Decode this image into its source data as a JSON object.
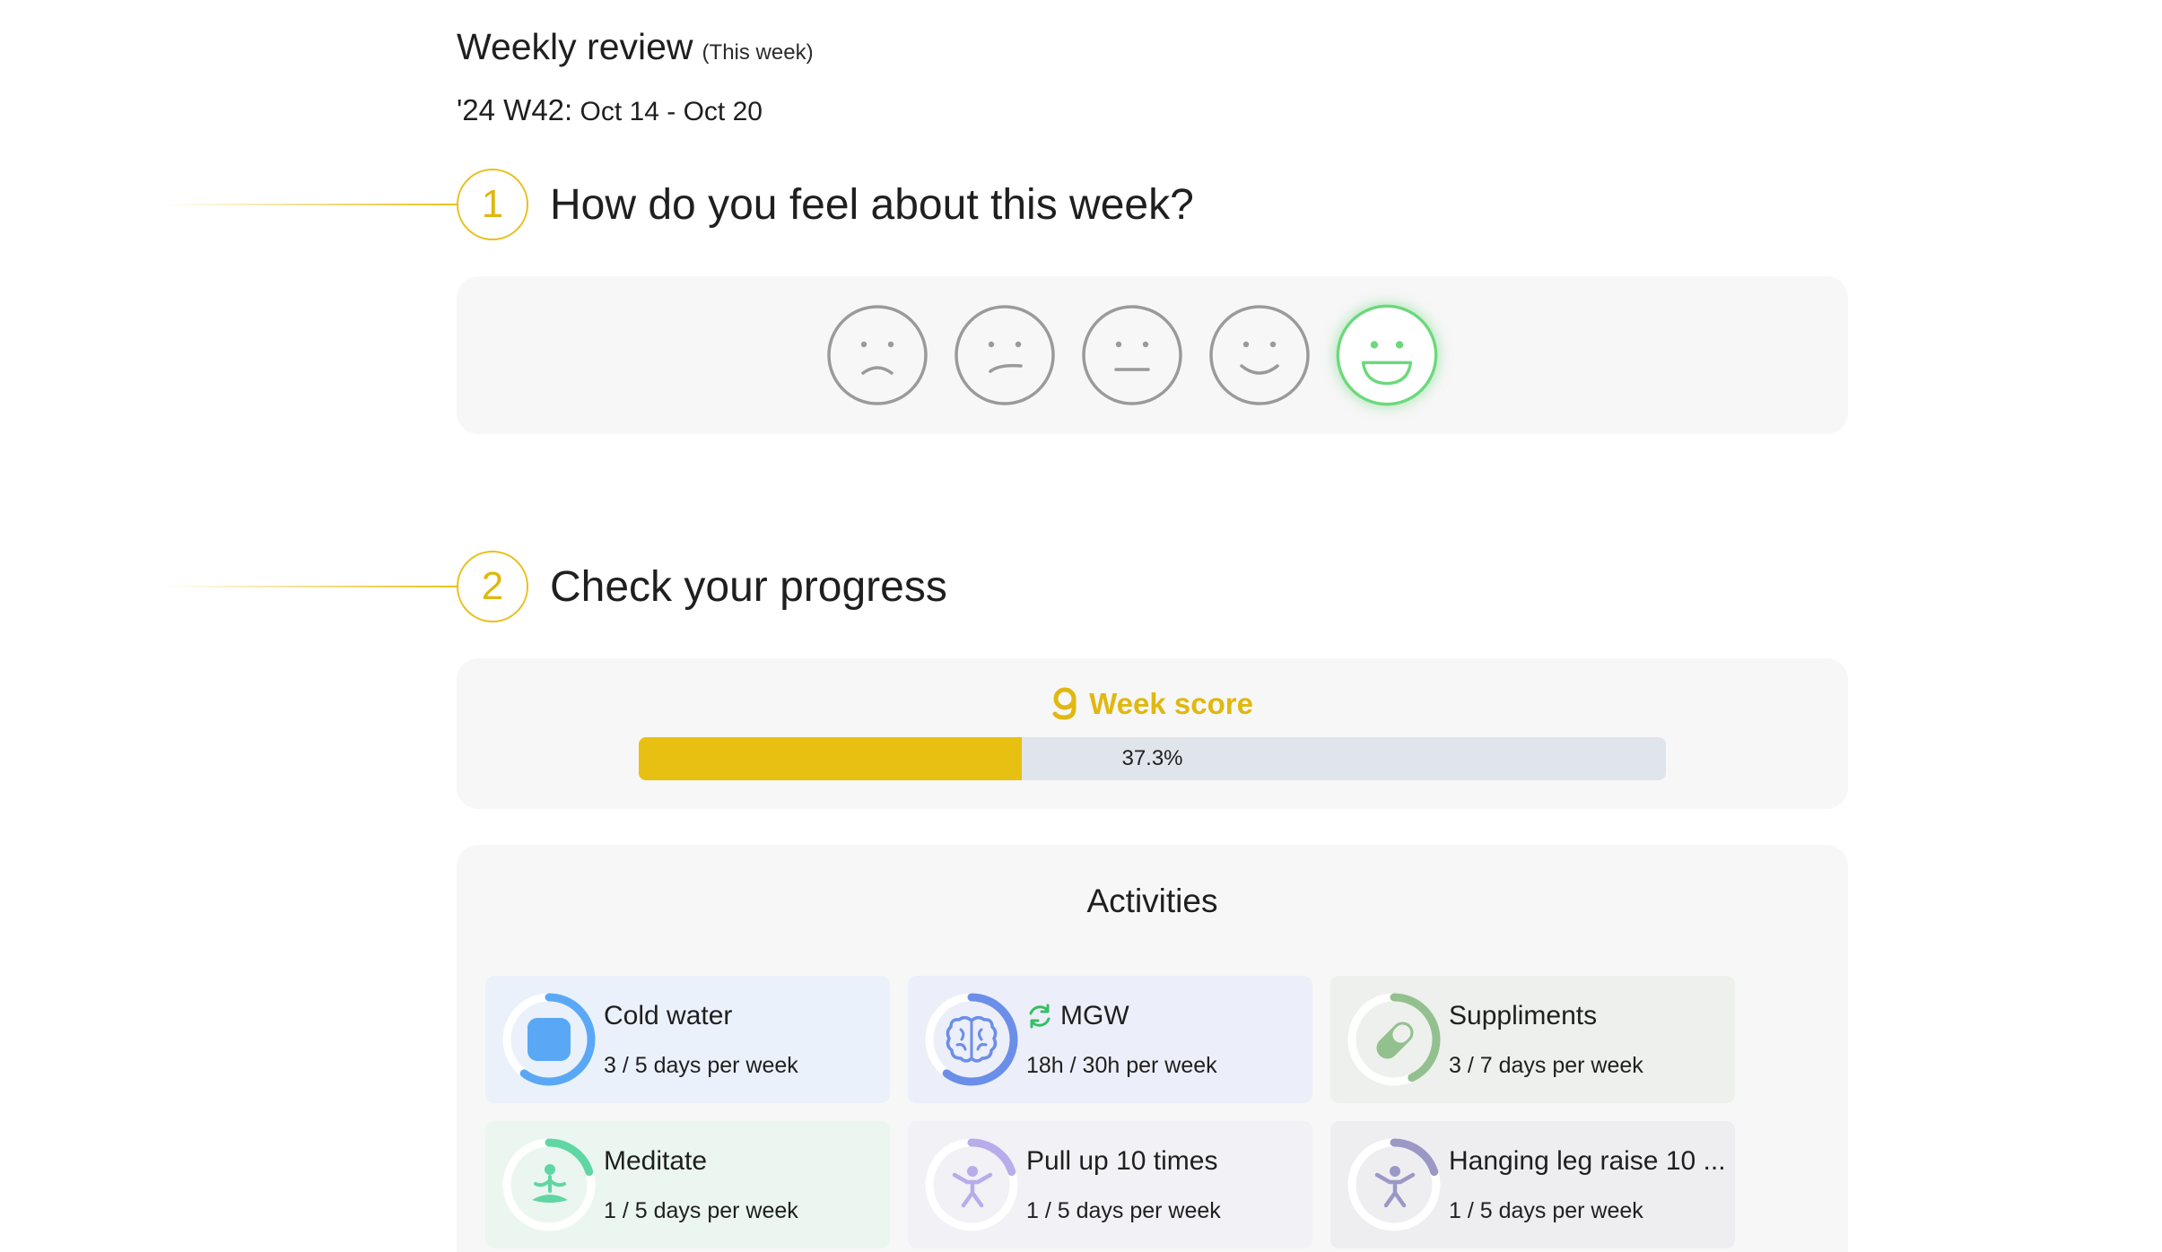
{
  "header": {
    "title": "Weekly review",
    "title_sub": "(This week)",
    "week_code": "'24 W42:",
    "week_range": "Oct 14 - Oct 20"
  },
  "step1": {
    "number": "1",
    "heading": "How do you feel about this week?",
    "moods": [
      {
        "icon": "sad-face-icon",
        "selected": false
      },
      {
        "icon": "confused-face-icon",
        "selected": false
      },
      {
        "icon": "neutral-face-icon",
        "selected": false
      },
      {
        "icon": "smile-face-icon",
        "selected": false
      },
      {
        "icon": "grin-face-icon",
        "selected": true
      }
    ]
  },
  "step2": {
    "number": "2",
    "heading": "Check your progress"
  },
  "score": {
    "title": "Week score",
    "icon": "g-logo-icon",
    "value_text": "37.3%",
    "value": 0.373,
    "color": "#e8c011"
  },
  "activities": {
    "title": "Activities",
    "items": [
      {
        "name": "Cold water",
        "progress": "3 / 5 days per week",
        "icon": "square-icon",
        "bg": "#eaf1fb",
        "accent": "#5aa8f5",
        "fraction": 0.6
      },
      {
        "name": "MGW",
        "progress": "18h / 30h per week",
        "icon": "brain-icon",
        "badge": "refresh-icon",
        "bg": "#eceef9",
        "accent": "#6b8ee8",
        "fraction": 0.6
      },
      {
        "name": "Suppliments",
        "progress": "3 / 7 days per week",
        "icon": "pill-icon",
        "bg": "#eef0ed",
        "accent": "#93c08f",
        "fraction": 0.43
      },
      {
        "name": "Meditate",
        "progress": "1 / 5 days per week",
        "icon": "meditation-icon",
        "bg": "#ebf6f0",
        "accent": "#5fd6a3",
        "fraction": 0.2
      },
      {
        "name": "Pull up 10 times",
        "progress": "1 / 5 days per week",
        "icon": "pullup-icon",
        "bg": "#f1f1f6",
        "accent": "#b8acea",
        "fraction": 0.2
      },
      {
        "name": "Hanging leg raise 10 ...",
        "progress": "1 / 5 days per week",
        "icon": "leg-raise-icon",
        "bg": "#eeeef1",
        "accent": "#9b98c6",
        "fraction": 0.2
      }
    ]
  }
}
